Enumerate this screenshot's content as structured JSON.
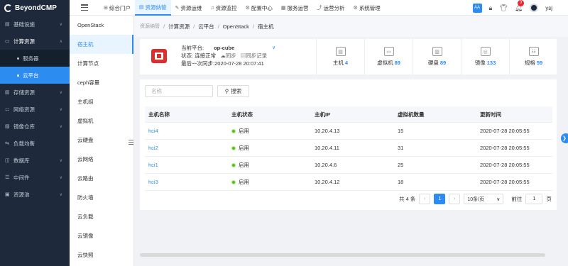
{
  "app": {
    "name": "BeyondCMP"
  },
  "topnav": [
    {
      "icon": "⊞",
      "label": "综合门户"
    },
    {
      "icon": "▤",
      "label": "资源纳管"
    },
    {
      "icon": "✎",
      "label": "资源运维"
    },
    {
      "icon": "♫",
      "label": "资源监控"
    },
    {
      "icon": "⚙",
      "label": "配置中心"
    },
    {
      "icon": "▦",
      "label": "服务运营"
    },
    {
      "icon": "⤴",
      "label": "运营分析"
    },
    {
      "icon": "⚙",
      "label": "系统管理"
    }
  ],
  "user": {
    "font_btn": "AA",
    "notifications": "0",
    "name": "ysj"
  },
  "sidebar": {
    "items": [
      {
        "icon": "▤",
        "label": "基础设施",
        "arrow": "∨"
      },
      {
        "icon": "▭",
        "label": "计算资源",
        "arrow": "∧"
      }
    ],
    "subitems": [
      "服务器",
      "云平台"
    ],
    "rest": [
      {
        "icon": "▥",
        "label": "存储资源",
        "arrow": "∨"
      },
      {
        "icon": "⚏",
        "label": "网络资源",
        "arrow": "∨"
      },
      {
        "icon": "▨",
        "label": "镜像仓库",
        "arrow": "∨"
      },
      {
        "icon": "⇆",
        "label": "负载均衡",
        "arrow": ""
      },
      {
        "icon": "◫",
        "label": "数据库",
        "arrow": "∨"
      },
      {
        "icon": "☰",
        "label": "中间件",
        "arrow": "∨"
      },
      {
        "icon": "▣",
        "label": "资源池",
        "arrow": "∨"
      }
    ]
  },
  "subnav": [
    "OpenStack",
    "宿主机",
    "计算节点",
    "ceph容量",
    "主机组",
    "虚拟机",
    "云硬盘",
    "云网络",
    "云路由",
    "防火墙",
    "云负载",
    "云镜像",
    "云快照"
  ],
  "breadcrumb": [
    "资源纳管",
    "计算资源",
    "云平台",
    "OpenStack",
    "宿主机"
  ],
  "platform": {
    "label": "当前平台:",
    "value": "op-cube",
    "status_label": "状态:",
    "status": "连接正常",
    "sync": "同步",
    "sync_log": "同步记录",
    "last_sync_label": "最后一次同步:",
    "last_sync": "2020-07-28 20:07:41"
  },
  "stats": [
    {
      "icon": "▤",
      "label": "主机",
      "value": "4"
    },
    {
      "icon": "▭",
      "label": "虚拟机",
      "value": "89"
    },
    {
      "icon": "▥",
      "label": "硬盘",
      "value": "89"
    },
    {
      "icon": "◎",
      "label": "镜像",
      "value": "133"
    },
    {
      "icon": "☷",
      "label": "规格",
      "value": "59"
    }
  ],
  "search": {
    "placeholder": "名称",
    "button": "搜索"
  },
  "table": {
    "headers": [
      "主机名称",
      "主机状态",
      "主机IP",
      "虚拟机数量",
      "更新时间"
    ],
    "rows": [
      {
        "name": "hci4",
        "status": "启用",
        "ip": "10.20.4.13",
        "vms": "15",
        "updated": "2020-07-28 20:05:55"
      },
      {
        "name": "hci2",
        "status": "启用",
        "ip": "10.20.4.11",
        "vms": "31",
        "updated": "2020-07-28 20:05:55"
      },
      {
        "name": "hci1",
        "status": "启用",
        "ip": "10.20.4.6",
        "vms": "25",
        "updated": "2020-07-28 20:05:55"
      },
      {
        "name": "hci3",
        "status": "启用",
        "ip": "10.20.4.12",
        "vms": "18",
        "updated": "2020-07-28 20:05:55"
      }
    ]
  },
  "pager": {
    "total": "共 4 条",
    "prev": "‹",
    "current": "1",
    "next": "›",
    "size": "10条/页",
    "goto": "前往",
    "page": "1",
    "page_unit": "页"
  },
  "float_btn": "❯",
  "colors": {
    "accent": "#2d8cf0",
    "sidebar": "#1e2a3b",
    "ok": "#52c41a",
    "brand_red": "#d9302f"
  }
}
